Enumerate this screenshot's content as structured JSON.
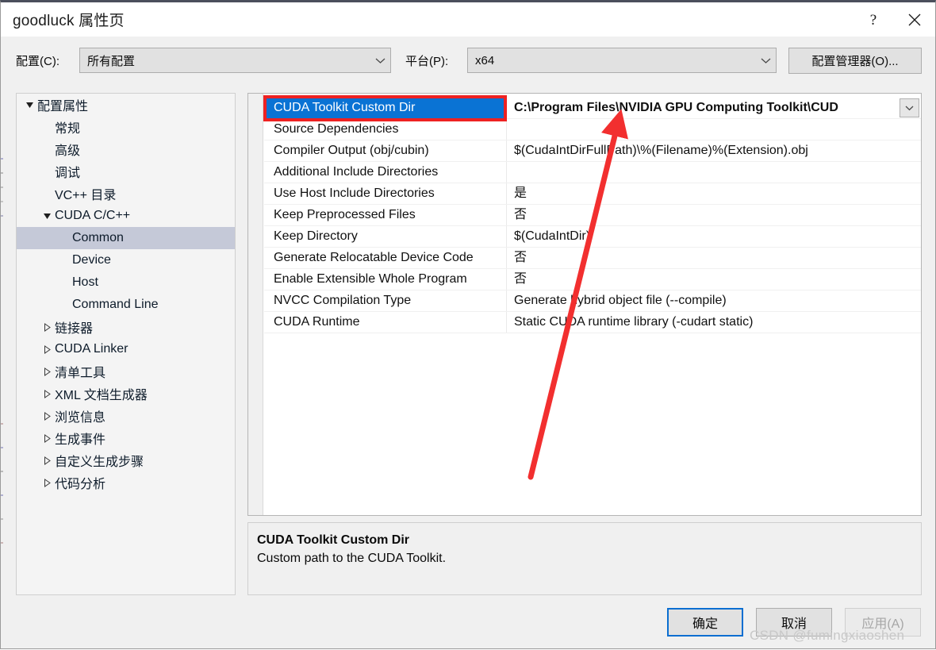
{
  "window": {
    "title": "goodluck 属性页",
    "help_icon": "question-mark-icon",
    "close_icon": "close-icon"
  },
  "config_bar": {
    "config_label": "配置(C):",
    "config_value": "所有配置",
    "platform_label": "平台(P):",
    "platform_value": "x64",
    "config_manager_button": "配置管理器(O)...",
    "dropdown_icon": "chevron-down-icon"
  },
  "tree": {
    "items": [
      {
        "label": "配置属性",
        "indent": 0,
        "twisty": "expanded",
        "selected": false
      },
      {
        "label": "常规",
        "indent": 1,
        "twisty": "none",
        "selected": false
      },
      {
        "label": "高级",
        "indent": 1,
        "twisty": "none",
        "selected": false
      },
      {
        "label": "调试",
        "indent": 1,
        "twisty": "none",
        "selected": false
      },
      {
        "label": "VC++ 目录",
        "indent": 1,
        "twisty": "none",
        "selected": false
      },
      {
        "label": "CUDA C/C++",
        "indent": 1,
        "twisty": "expanded",
        "selected": false
      },
      {
        "label": "Common",
        "indent": 2,
        "twisty": "none",
        "selected": true
      },
      {
        "label": "Device",
        "indent": 2,
        "twisty": "none",
        "selected": false
      },
      {
        "label": "Host",
        "indent": 2,
        "twisty": "none",
        "selected": false
      },
      {
        "label": "Command Line",
        "indent": 2,
        "twisty": "none",
        "selected": false
      },
      {
        "label": "链接器",
        "indent": 1,
        "twisty": "collapsed",
        "selected": false
      },
      {
        "label": "CUDA Linker",
        "indent": 1,
        "twisty": "collapsed",
        "selected": false
      },
      {
        "label": "清单工具",
        "indent": 1,
        "twisty": "collapsed",
        "selected": false
      },
      {
        "label": "XML 文档生成器",
        "indent": 1,
        "twisty": "collapsed",
        "selected": false
      },
      {
        "label": "浏览信息",
        "indent": 1,
        "twisty": "collapsed",
        "selected": false
      },
      {
        "label": "生成事件",
        "indent": 1,
        "twisty": "collapsed",
        "selected": false
      },
      {
        "label": "自定义生成步骤",
        "indent": 1,
        "twisty": "collapsed",
        "selected": false
      },
      {
        "label": "代码分析",
        "indent": 1,
        "twisty": "collapsed",
        "selected": false
      }
    ]
  },
  "property_grid": {
    "rows": [
      {
        "name": "CUDA Toolkit Custom Dir",
        "value": "C:\\Program Files\\NVIDIA GPU Computing Toolkit\\CUD",
        "selected": true,
        "has_dropdown": true
      },
      {
        "name": "Source Dependencies",
        "value": "",
        "selected": false,
        "has_dropdown": false
      },
      {
        "name": "Compiler Output (obj/cubin)",
        "value": "$(CudaIntDirFullPath)\\%(Filename)%(Extension).obj",
        "selected": false,
        "has_dropdown": false
      },
      {
        "name": "Additional Include Directories",
        "value": "",
        "selected": false,
        "has_dropdown": false
      },
      {
        "name": "Use Host Include Directories",
        "value": "是",
        "selected": false,
        "has_dropdown": false
      },
      {
        "name": "Keep Preprocessed Files",
        "value": "否",
        "selected": false,
        "has_dropdown": false
      },
      {
        "name": "Keep Directory",
        "value": "$(CudaIntDir)",
        "selected": false,
        "has_dropdown": false
      },
      {
        "name": "Generate Relocatable Device Code",
        "value": "否",
        "selected": false,
        "has_dropdown": false
      },
      {
        "name": "Enable Extensible Whole Program",
        "value": "否",
        "selected": false,
        "has_dropdown": false
      },
      {
        "name": "NVCC Compilation Type",
        "value": "Generate hybrid object file (--compile)",
        "selected": false,
        "has_dropdown": false
      },
      {
        "name": "CUDA Runtime",
        "value": "Static CUDA runtime library (-cudart static)",
        "selected": false,
        "has_dropdown": false
      }
    ]
  },
  "description": {
    "title": "CUDA Toolkit Custom Dir",
    "body": "Custom path to the CUDA Toolkit."
  },
  "footer": {
    "ok": "确定",
    "cancel": "取消",
    "apply": "应用(A)"
  },
  "annotations": {
    "highlight_color": "#ee2222",
    "arrow_color": "#f22f2f"
  },
  "watermark": "CSDN @fumingxiaoshen",
  "colors": {
    "selection_blue": "#0a73d4",
    "tree_selection": "#c5c9d8",
    "default_button_border": "#0a6ed1",
    "dialog_background": "#f0f0f0"
  }
}
